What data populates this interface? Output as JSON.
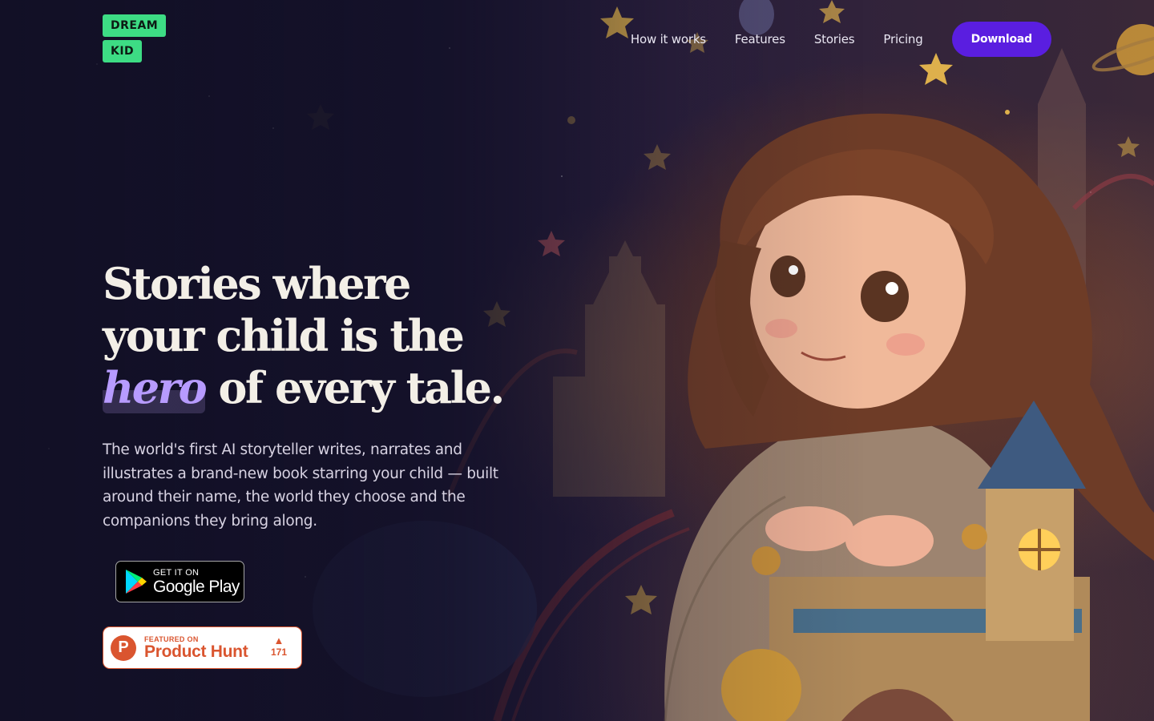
{
  "brand": {
    "line1": "DREAM",
    "line2": "KID",
    "color": "#3ddc84"
  },
  "nav": {
    "links": [
      "How it works",
      "Features",
      "Stories",
      "Pricing"
    ],
    "download_label": "Download",
    "accent": "#5a1ee0"
  },
  "hero": {
    "headline_part1": "Stories where your child is the ",
    "headline_highlight": "hero",
    "headline_part2": " of every tale.",
    "subtitle": "The world's first AI storyteller writes, narrates and illustrates a brand-new book starring your child — built around their name, the world they choose and the companions they bring along."
  },
  "badges": {
    "google_play": {
      "small": "GET IT ON",
      "big": "Google Play"
    },
    "product_hunt": {
      "small": "FEATURED ON",
      "big": "Product Hunt",
      "votes": "171",
      "color": "#da552f"
    }
  },
  "illustration": {
    "icon": "girl-with-castle-illustration"
  }
}
